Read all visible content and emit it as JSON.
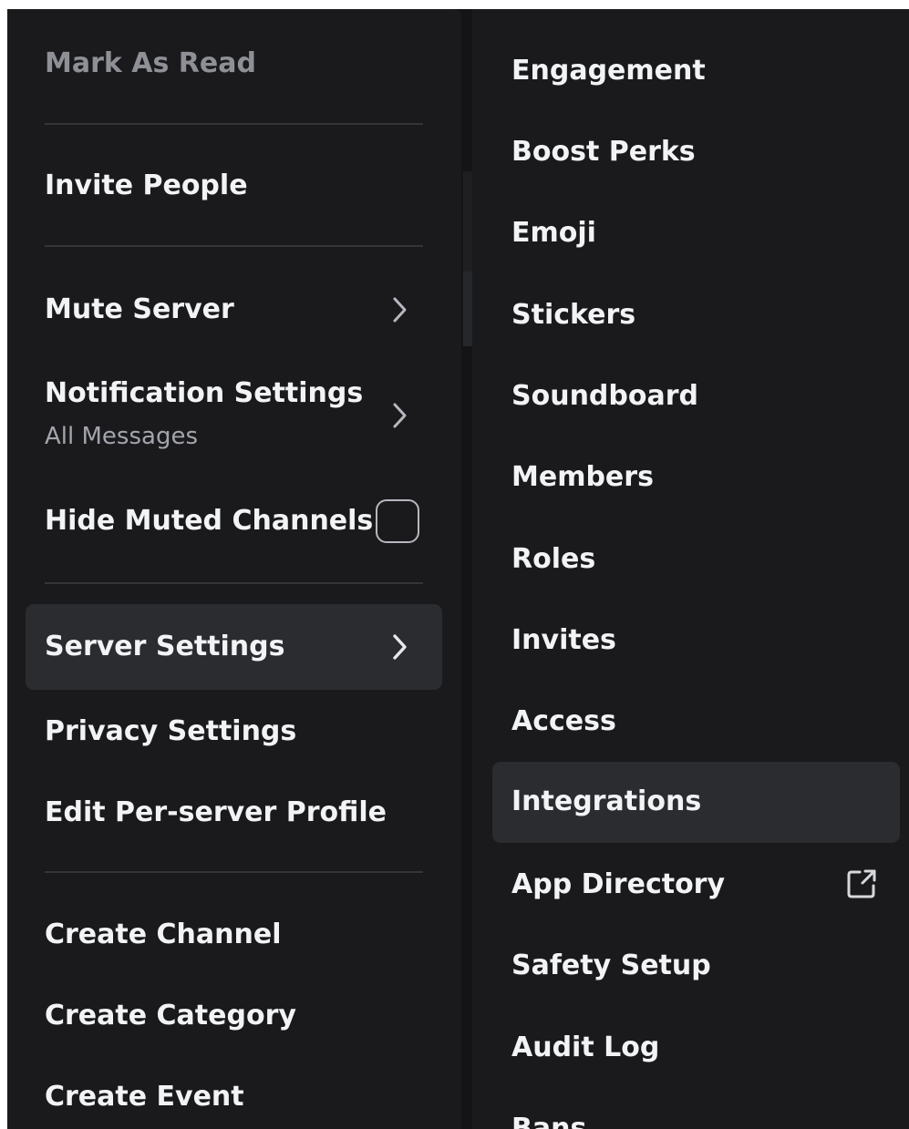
{
  "left_menu": {
    "mark_as_read": "Mark As Read",
    "invite_people": "Invite People",
    "mute_server": "Mute Server",
    "notification_settings": "Notification Settings",
    "notification_settings_value": "All Messages",
    "hide_muted_channels": "Hide Muted Channels",
    "hide_muted_channels_checked": false,
    "server_settings": "Server Settings",
    "privacy_settings": "Privacy Settings",
    "edit_per_server_profile": "Edit Per-server Profile",
    "create_channel": "Create Channel",
    "create_category": "Create Category",
    "create_event": "Create Event"
  },
  "right_menu": {
    "items": [
      "Engagement",
      "Boost Perks",
      "Emoji",
      "Stickers",
      "Soundboard",
      "Members",
      "Roles",
      "Invites",
      "Access",
      "Integrations",
      "App Directory",
      "Safety Setup",
      "Audit Log",
      "Bans"
    ],
    "active_item": "Integrations",
    "external_link_item": "App Directory"
  },
  "icons": {
    "submenu": "chevron-right-icon",
    "external": "external-link-icon",
    "toggle": "checkbox-icon"
  },
  "colors": {
    "menu_background": "#1a1a1d",
    "highlight": "#2b2c30",
    "text": "#f2f3f5",
    "muted_text": "#8e9096",
    "separator": "#34353a"
  }
}
